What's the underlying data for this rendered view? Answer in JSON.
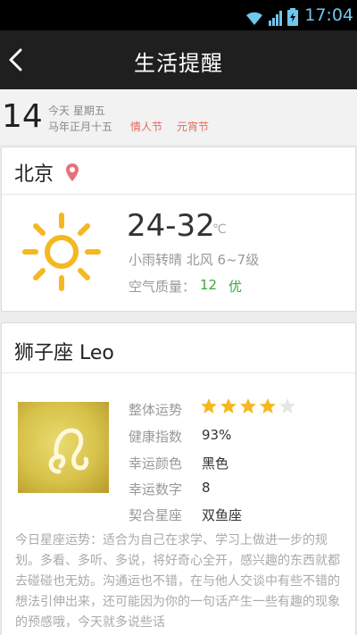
{
  "status_bar": {
    "time": "17:04"
  },
  "nav": {
    "title": "生活提醒",
    "back_icon": "chevron-left-icon"
  },
  "date": {
    "day": "14",
    "line1": "今天  星期五",
    "line2": "马年正月十五",
    "festivals": [
      "情人节",
      "元宵节"
    ]
  },
  "weather": {
    "city": "北京",
    "temp": "24-32",
    "unit": "℃",
    "desc": "小雨转晴   北风  6~7级",
    "air_label": "空气质量：",
    "air_value": "12",
    "air_level": "优",
    "colors": {
      "sun": "#f5b820",
      "good": "#3aaa3a",
      "pin": "#e8707a"
    }
  },
  "horoscope": {
    "sign": "狮子座 Leo",
    "rows": [
      {
        "label": "整体运势",
        "stars_filled": 4,
        "stars_total": 5
      },
      {
        "label": "健康指数",
        "value": "93%"
      },
      {
        "label": "幸运颜色",
        "value": "黑色"
      },
      {
        "label": "幸运数字",
        "value": "8"
      },
      {
        "label": "契合星座",
        "value": "双鱼座"
      }
    ],
    "paragraph": "今日星座运势：适合为自己在求学、学习上做进一步的规划。多看、多听、多说，将好奇心全开，感兴趣的东西就都去碰碰也无妨。沟通运也不错，在与他人交谈中有些不错的想法引伸出来，还可能因为你的一句话产生一些有趣的现象的预感哦，今天就多说些话"
  }
}
